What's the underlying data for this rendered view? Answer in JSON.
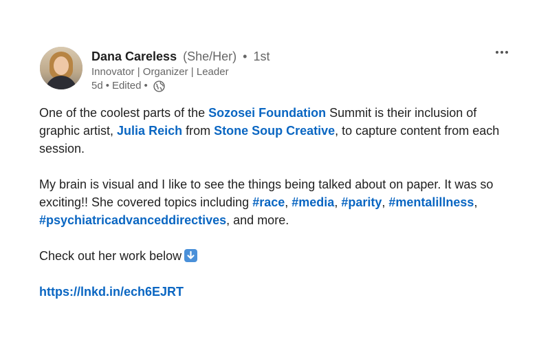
{
  "author": {
    "name": "Dana Careless",
    "pronouns": "(She/Her)",
    "degree": "1st",
    "headline": "Innovator | Organizer | Leader",
    "time": "5d",
    "edited": "Edited"
  },
  "icons": {
    "more": "more-horizontal-icon",
    "visibility": "globe-icon",
    "emoji": "down-arrow-emoji-icon"
  },
  "colors": {
    "link": "#0a66c2",
    "text": "#1f1f1f",
    "muted": "#666666"
  },
  "post": {
    "p1": {
      "t1": "One of the coolest parts of the ",
      "l1": "Sozosei Foundation",
      "t2": " Summit is their inclusion of graphic artist, ",
      "l2": "Julia Reich",
      "t3": " from ",
      "l3": "Stone Soup Creative",
      "t4": ", to capture content from each session."
    },
    "p2": {
      "t1": "My brain is visual and I like to see the things being talked about on paper. It was so exciting!! She covered topics including ",
      "h1": "#race",
      "s1": ", ",
      "h2": "#media",
      "s2": ", ",
      "h3": "#parity",
      "s3": ", ",
      "h4": "#mentalillness",
      "s4": ", ",
      "h5": "#psychiatricadvanceddirectives",
      "t2": ", and more."
    },
    "p3": {
      "t1": "Check out her work below"
    },
    "url": "https://lnkd.in/ech6EJRT"
  }
}
